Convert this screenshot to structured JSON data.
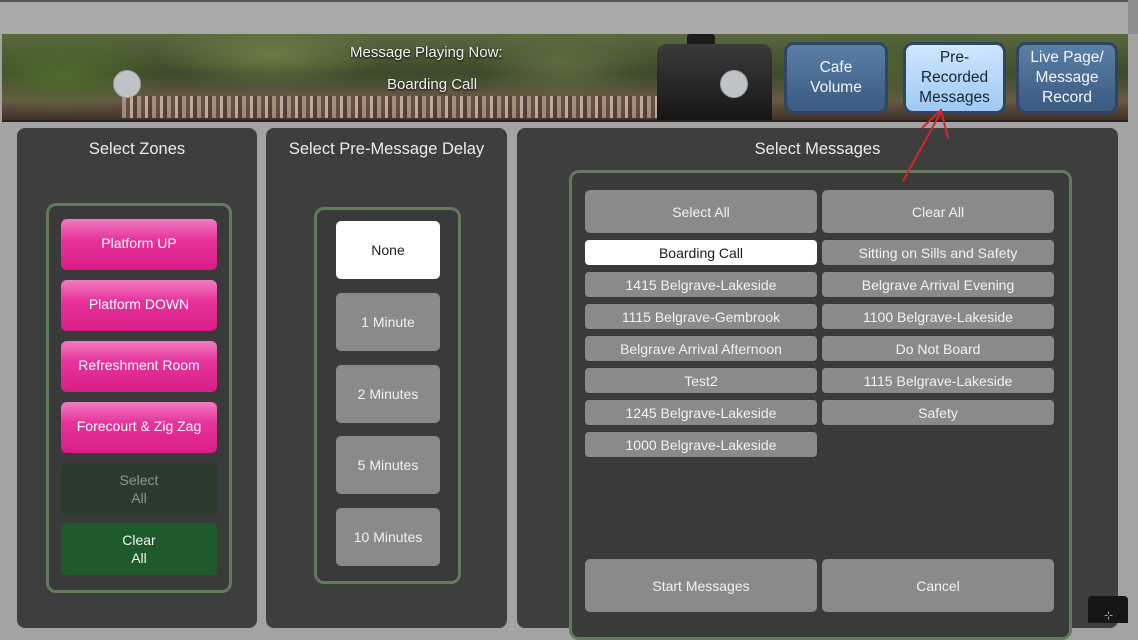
{
  "header": {
    "now_playing_label": "Message Playing Now:",
    "now_playing_value": "Boarding Call",
    "buttons": [
      {
        "label": "Cafe\nVolume",
        "active": false
      },
      {
        "label": "Pre-\nRecorded\nMessages",
        "active": true
      },
      {
        "label": "Live Page/\nMessage\nRecord",
        "active": false
      }
    ]
  },
  "zones": {
    "title": "Select Zones",
    "items": [
      "Platform UP",
      "Platform DOWN",
      "Refreshment Room",
      "Forecourt & Zig Zag"
    ],
    "select_all": "Select\nAll",
    "clear_all": "Clear\nAll"
  },
  "delay": {
    "title": "Select Pre-Message Delay",
    "options": [
      "None",
      "1 Minute",
      "2 Minutes",
      "5 Minutes",
      "10 Minutes"
    ],
    "selected": "None"
  },
  "messages": {
    "title": "Select Messages",
    "select_all": "Select All",
    "clear_all": "Clear All",
    "left": [
      "Boarding Call",
      "1415 Belgrave-Lakeside",
      "1115 Belgrave-Gembrook",
      "Belgrave Arrival Afternoon",
      "Test2",
      "1245 Belgrave-Lakeside",
      "1000 Belgrave-Lakeside"
    ],
    "right": [
      "Sitting on Sills and Safety",
      "Belgrave Arrival Evening",
      "1100 Belgrave-Lakeside",
      "Do Not Board",
      "1115 Belgrave-Lakeside",
      "Safety"
    ],
    "selected": "Boarding Call",
    "start": "Start Messages",
    "cancel": "Cancel"
  },
  "colors": {
    "zone_pink": "#e7349c",
    "panel_bg": "#3e3e3e",
    "group_border": "#647a5c",
    "button_gray": "#8a8a8a",
    "header_blue": "#3a5a80",
    "annotation_red": "#d8252a"
  }
}
